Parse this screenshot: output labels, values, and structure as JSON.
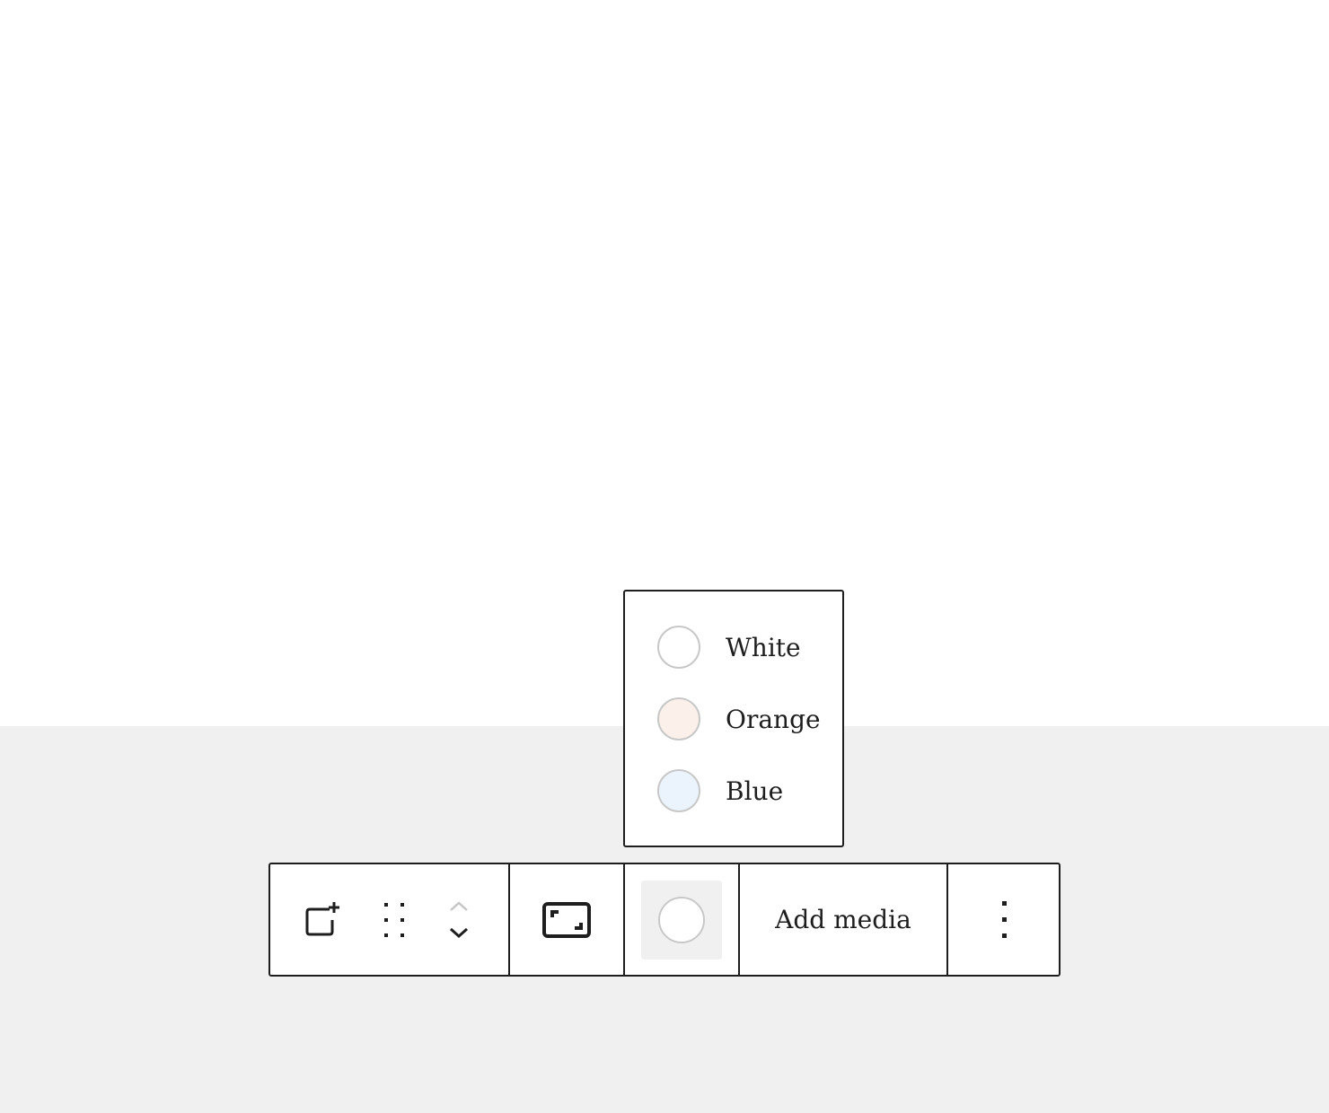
{
  "color_menu": {
    "options": [
      {
        "label": "White",
        "color": "#ffffff"
      },
      {
        "label": "Orange",
        "color": "#fcf0ea"
      },
      {
        "label": "Blue",
        "color": "#ebf3fd"
      }
    ]
  },
  "toolbar": {
    "add_block_icon": "add-block-icon",
    "drag_handle_icon": "drag-handle-icon",
    "move_up_icon": "chevron-up-icon",
    "move_down_icon": "chevron-down-icon",
    "aspect_ratio_icon": "aspect-ratio-icon",
    "current_color": "#ffffff",
    "add_media_label": "Add media",
    "more_options_icon": "more-vertical-icon"
  },
  "colors": {
    "canvas_top": "#ffffff",
    "canvas_bottom": "#f0f0f0",
    "border": "#1e1e1e",
    "swatch_border": "#c8c8c8"
  }
}
